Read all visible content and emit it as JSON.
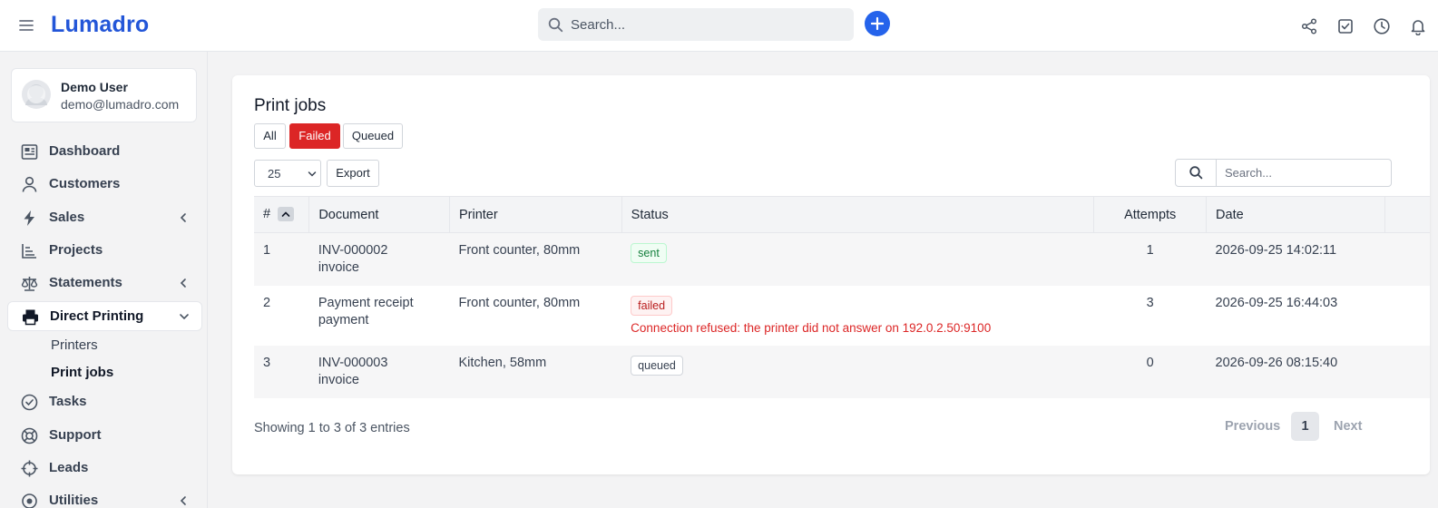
{
  "app": {
    "brand": "Lumadro"
  },
  "topbar": {
    "search_placeholder": "Search..."
  },
  "user": {
    "name": "Demo User",
    "email": "demo@lumadro.com"
  },
  "sidebar": {
    "items": [
      {
        "label": "Dashboard",
        "icon": "dashboard-icon"
      },
      {
        "label": "Customers",
        "icon": "user-icon"
      },
      {
        "label": "Sales",
        "icon": "bolt-icon",
        "expandable": true
      },
      {
        "label": "Projects",
        "icon": "chart-icon"
      },
      {
        "label": "Statements",
        "icon": "scale-icon",
        "expandable": true
      },
      {
        "label": "Direct Printing",
        "icon": "printer-icon",
        "expanded": true
      },
      {
        "label": "Tasks",
        "icon": "check-circle-icon"
      },
      {
        "label": "Support",
        "icon": "lifebuoy-icon"
      },
      {
        "label": "Leads",
        "icon": "crosshair-icon"
      },
      {
        "label": "Utilities",
        "icon": "gear-icon",
        "expandable": true
      }
    ],
    "subitems": [
      "Printers",
      "Print jobs"
    ]
  },
  "page": {
    "title": "Print jobs",
    "filters": [
      "All",
      "Failed",
      "Queued"
    ],
    "active_filter": "Failed",
    "page_length": "25",
    "export_label": "Export",
    "table_search_placeholder": "Search...",
    "columns": [
      "#",
      "Document",
      "Printer",
      "Status",
      "Attempts",
      "Date"
    ],
    "rows": [
      {
        "num": "1",
        "doc": "INV-000002",
        "doc_type": "invoice",
        "printer": "Front counter, 80mm",
        "status": "sent",
        "error": "",
        "attempts": "1",
        "date": "2026-09-25 14:02:11"
      },
      {
        "num": "2",
        "doc": "Payment receipt",
        "doc_type": "payment",
        "printer": "Front counter, 80mm",
        "status": "failed",
        "error": "Connection refused: the printer did not answer on 192.0.2.50:9100",
        "attempts": "3",
        "date": "2026-09-25 16:44:03"
      },
      {
        "num": "3",
        "doc": "INV-000003",
        "doc_type": "invoice",
        "printer": "Kitchen, 58mm",
        "status": "queued",
        "error": "",
        "attempts": "0",
        "date": "2026-09-26 08:15:40"
      }
    ],
    "showing": "Showing 1 to 3 of 3 entries",
    "pagination": {
      "previous": "Previous",
      "current": "1",
      "next": "Next"
    }
  },
  "colors": {
    "brand": "#2356d8",
    "accent": "#2563eb",
    "danger": "#dc2626",
    "success": "#15803d"
  }
}
